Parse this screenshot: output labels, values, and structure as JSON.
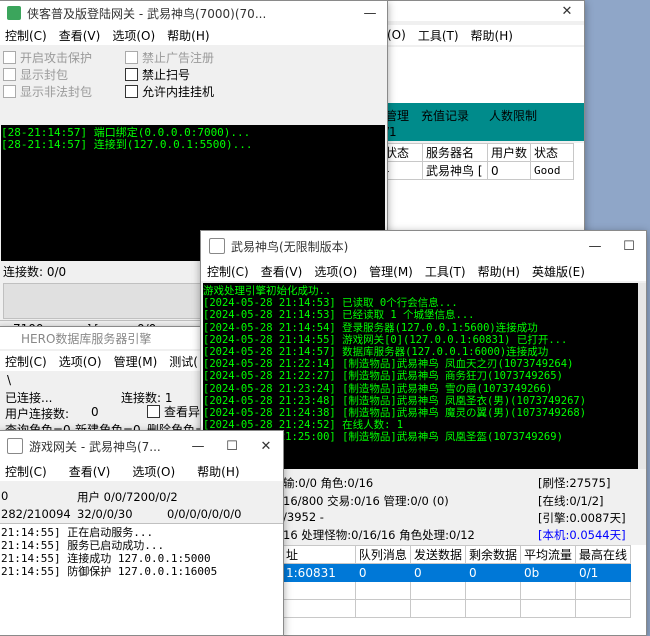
{
  "win1": {
    "menu": [
      "(O)",
      "工具(T)",
      "帮助(H)"
    ],
    "close_glyph": "✕",
    "tabs": [
      "管理",
      "充值记录",
      "人数限制"
    ],
    "tab_sub": "/1",
    "table_headers": [
      "状态",
      "服务器名",
      "用户数",
      "状态"
    ],
    "table_row": [
      "-",
      "武易神鸟 [",
      "0",
      "Good"
    ]
  },
  "win2": {
    "title": "侠客普及版登陆网关 - 武易神鸟(7000)(70...",
    "min_glyph": "—",
    "menu": [
      "控制(C)",
      "查看(V)",
      "选项(O)",
      "帮助(H)"
    ],
    "checks_left": [
      {
        "label": "开启攻击保护",
        "disabled": true
      },
      {
        "label": "显示封包",
        "disabled": true
      },
      {
        "label": "显示非法封包",
        "disabled": true
      }
    ],
    "checks_right": [
      {
        "label": "禁止广告注册",
        "disabled": true
      },
      {
        "label": "禁止扫号",
        "disabled": false
      },
      {
        "label": "允许内挂挂机",
        "disabled": false
      }
    ],
    "log": [
      "[28-21:14:57] 端口绑定(0.0.0.0:7000)...",
      "[28-21:14:57] 连接到(127.0.0.1:5500)..."
    ],
    "conn_label": "连接数: 0/0",
    "status": [
      "7100",
      "-----][-----",
      "0/0"
    ]
  },
  "win3": {
    "title": "HERO数据库服务器引擎",
    "menu": [
      "控制(C)",
      "选项(O)",
      "管理(M)",
      "测试("
    ],
    "line0": "\\",
    "connected": "已连接...",
    "conn_count": "连接数:  1",
    "user_conn": "用户连接数:",
    "user_conn_val": "0",
    "check_label": "查看异",
    "query_role": "查询角色=0",
    "new_role": "新建角色=0",
    "del_role": "删除角色="
  },
  "win4": {
    "title": "游戏网关 - 武易神鸟(7...",
    "min_glyph": "—",
    "max_glyph": "☐",
    "close_glyph": "✕",
    "menu": [
      "控制(C)",
      "查看(V)",
      "选项(O)",
      "帮助(H)"
    ],
    "row1_a": "0",
    "row1_b": "用户 0/0/7200/0/2",
    "row2_a": "282/210094",
    "row2_b": "32/0/0/30",
    "row2_c": "0/0/0/0/0/0/0",
    "log": [
      "21:14:55] 正在启动服务...",
      "21:14:55] 服务已启动成功...",
      "21:14:55] 连接成功 127.0.0.1:5000",
      "21:14:55] 防御保护 127.0.0.1:16005"
    ]
  },
  "win5": {
    "title": "武易神鸟(无限制版本)",
    "min_glyph": "—",
    "max_glyph": "☐",
    "menu": [
      "控制(C)",
      "查看(V)",
      "选项(O)",
      "管理(M)",
      "工具(T)",
      "帮助(H)",
      "英雄版(E)"
    ],
    "log": [
      "游戏处理引擎初始化成功..",
      "[2024-05-28 21:14:53] 已读取 0个行会信息...",
      "[2024-05-28 21:14:53] 已经读取 1 个城堡信息...",
      "[2024-05-28 21:14:54] 登录服务器(127.0.0.1:5600)连接成功",
      "[2024-05-28 21:14:55] 游戏网关[0](127.0.0.1:60831) 已打开...",
      "[2024-05-28 21:14:57] 数据库服务器(127.0.0.1:6000)连接成功",
      "[2024-05-28 21:22:14] [制造物品]武易神鸟 凤血天之刃(1073749264)",
      "[2024-05-28 21:22:27] [制造物品]武易神鸟 商务狂刀(1073749265)",
      "[2024-05-28 21:23:24] [制造物品]武易神鸟 雪の扇(1073749266)",
      "[2024-05-28 21:23:48] [制造物品]武易神鸟 凤凰圣衣(男)(1073749267)",
      "[2024-05-28 21:24:38] [制造物品]武易神鸟 魔灵の翼(男)(1073749268)",
      "[2024-05-28 21:24:52] 在线人数: 1",
      "[2024-05-28 21:25:00] [制造物品]武易神鸟 凤凰圣盔(1073749269)"
    ],
    "stat1": "输:0/0  角色:0/16",
    "stat2": "16/800  交易:0/16  管理:0/0 (0)",
    "stat3": "/3952 -",
    "stat4": "16  处理怪物:0/16/16  角色处理:0/12",
    "right1": "[刷怪:27575]",
    "right2": "[在线:0/1/2]",
    "right3": "[引擎:0.0087天]",
    "right4": "[本机:0.0544天]",
    "cols": [
      "址",
      "队列消息",
      "发送数据",
      "剩余数据",
      "平均流量",
      "最高在线"
    ],
    "row": [
      "1:60831",
      "0",
      "0",
      "0",
      "0b",
      "0/1"
    ]
  },
  "colors": {
    "console_green": "#00ff00",
    "teal_bar": "#008b8b",
    "selection": "#0078d7",
    "engine_blue": "#0000ff"
  }
}
